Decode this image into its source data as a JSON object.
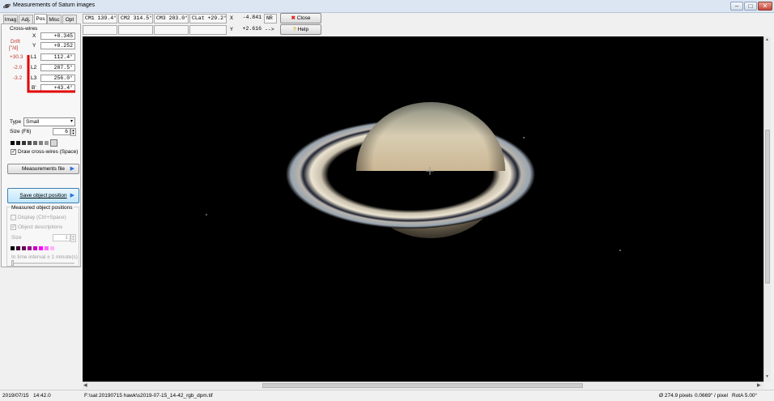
{
  "window": {
    "title": "Measurements of Saturn images"
  },
  "tabs": [
    "Imag",
    "Adj.",
    "Pos",
    "Misc",
    "Opt"
  ],
  "active_tab": "Pos",
  "crosswires": {
    "heading": "Cross-wires",
    "drift_label": "Drift",
    "drift_unit": "[\"/d]",
    "x_label": "X",
    "x_value": "+0.345",
    "y_label": "Y",
    "y_value": "+0.252",
    "l1_label": "L1",
    "l1_value": "112.4°",
    "l1_drift": "+30.3",
    "l2_label": "L2",
    "l2_value": "287.5°",
    "l2_drift": "-2.0",
    "l3_label": "L3",
    "l3_value": "256.0°",
    "l3_drift": "-3.2",
    "b_label": "B'",
    "b_value": "+43.4°"
  },
  "crosswire_style": {
    "type_label": "Type",
    "type_value": "Small",
    "size_label": "Size (F6)",
    "size_value": "6",
    "colors": [
      "#000000",
      "#1a1a1a",
      "#333333",
      "#4d4d4d",
      "#666666",
      "#808080",
      "#999999",
      "#d8d8d8"
    ],
    "draw_label": "Draw cross-wires (Space)"
  },
  "measurements_file_button": "Measurements file",
  "save_position_button": "Save object position",
  "measured_positions": {
    "heading": "Measured object positions",
    "display_label": "Display (Ctrl+Space)",
    "descriptions_label": "Object descriptions",
    "size_label": "Size",
    "size_value": "1",
    "colors": [
      "#000000",
      "#3a0030",
      "#6b005a",
      "#9a0090",
      "#c800c0",
      "#ff00ff",
      "#ff66ff",
      "#ffb3ff"
    ],
    "interval_label": "In time interval ± 1 minute(s)"
  },
  "toolbar": {
    "cm1": "CM1 139.4°",
    "cm2": "CM2 314.5°",
    "cm3": "CM3 283.0°",
    "clat": "CLat +29.2°",
    "x_label": "X",
    "x_value": "-4.841",
    "y_label": "Y",
    "y_value": "+2.616",
    "nr": "NR",
    "arrow": "-->",
    "close_button": "Close",
    "help_button": "Help"
  },
  "status": {
    "date": "2019/07/15",
    "time": "14:42.0",
    "file": "F:\\sat 20190715 hawk\\s2019-07-15_14-42_rgb_dpm.tif",
    "diameter": "Ø 274.9 pixels",
    "scale": "0.0669\" / pixel",
    "rotation": "RotA 5.00°"
  },
  "colors": {
    "accent_red": "#e00000",
    "drift_red": "#c0392b"
  },
  "icons": [
    "app-icon",
    "close-x-icon",
    "help-icon",
    "play-arrow-icon",
    "scroll-arrow-icon"
  ]
}
